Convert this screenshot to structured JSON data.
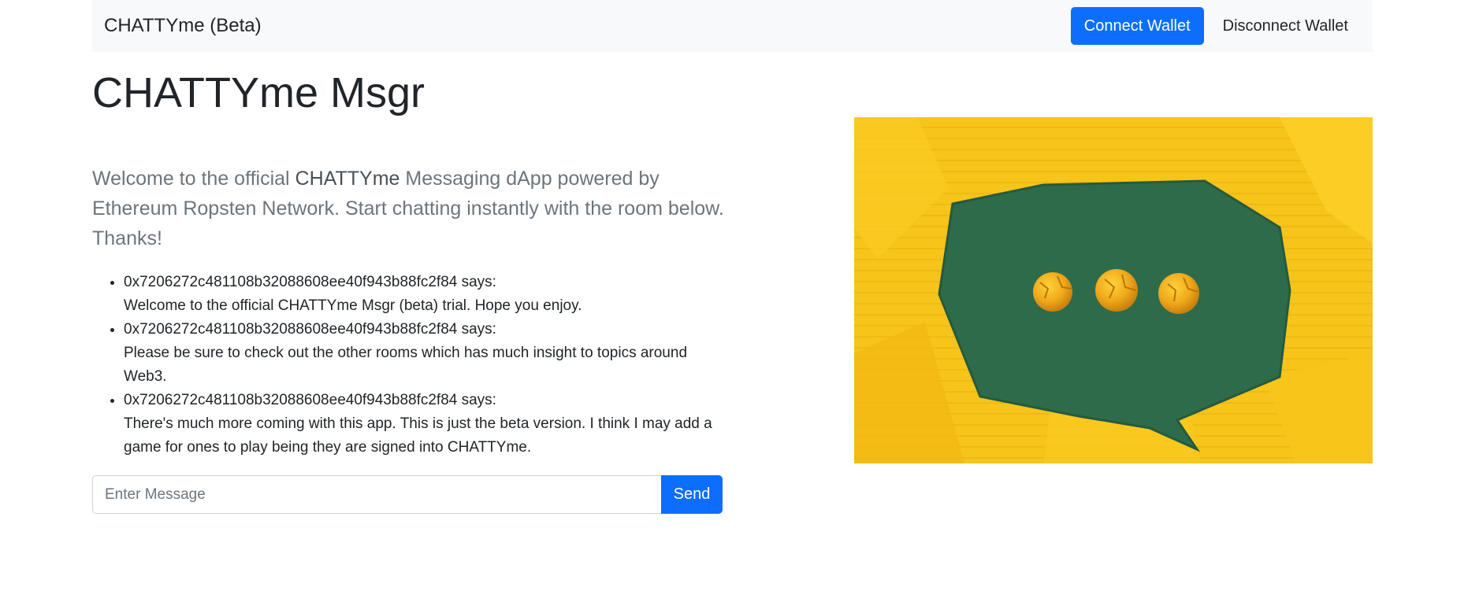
{
  "navbar": {
    "brand": "CHATTYme (Beta)",
    "connect_label": "Connect Wallet",
    "disconnect_label": "Disconnect Wallet"
  },
  "page": {
    "title": "CHATTYme Msgr",
    "intro_before": "Welcome to the official ",
    "intro_em": "CHATTYme",
    "intro_after": " Messaging dApp powered by Ethereum Ropsten Network. Start chatting instantly with the room below. Thanks!"
  },
  "messages": [
    {
      "sender": "0x7206272c481108b32088608ee40f943b88fc2f84 says:",
      "text": "Welcome to the official CHATTYme Msgr (beta) trial. Hope you enjoy."
    },
    {
      "sender": "0x7206272c481108b32088608ee40f943b88fc2f84 says:",
      "text": "Please be sure to check out the other rooms which has much insight to topics around Web3."
    },
    {
      "sender": "0x7206272c481108b32088608ee40f943b88fc2f84 says:",
      "text": "There's much more coming with this app. This is just the beta version. I think I may add a game for ones to play being they are signed into CHATTYme."
    }
  ],
  "composer": {
    "placeholder": "Enter Message",
    "value": "",
    "send_label": "Send"
  },
  "colors": {
    "primary": "#0d6efd",
    "navbar_bg": "#f8f9fa",
    "lead_text": "#6c757d",
    "hero_yellow": "#f6c316",
    "hero_green": "#2e6b4b"
  },
  "hero": {
    "icon": "speech-bubble-image"
  }
}
